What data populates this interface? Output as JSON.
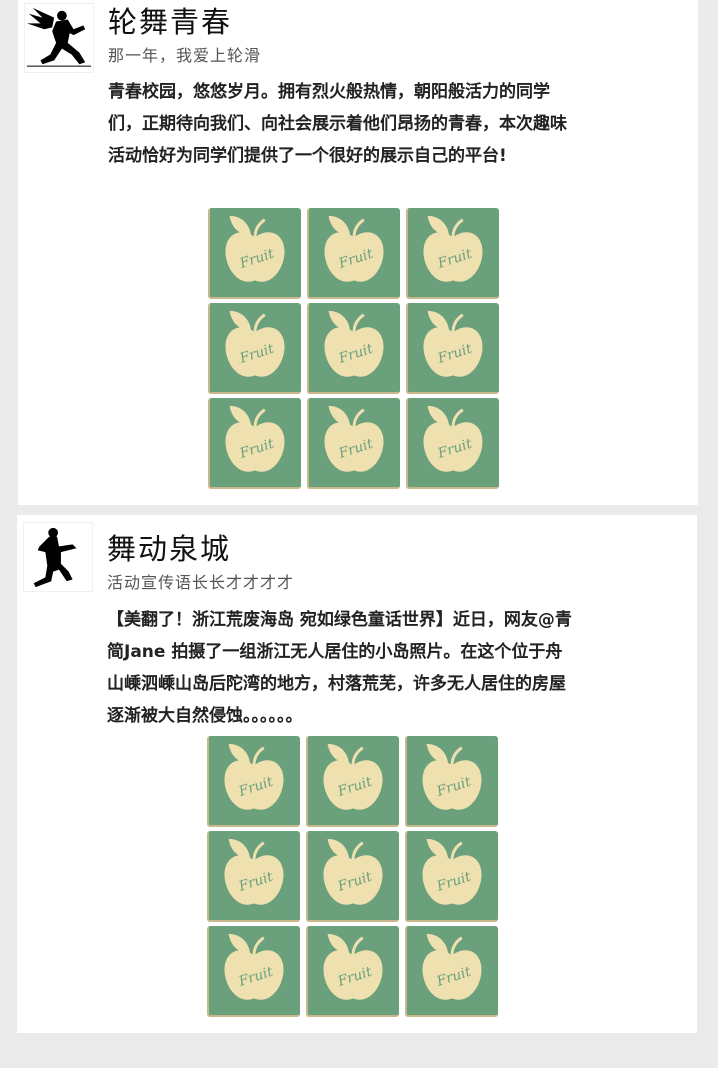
{
  "posts": [
    {
      "title": "轮舞青春",
      "subtitle": "那一年，我爱上轮滑",
      "content": "青春校园，悠悠岁月。拥有烈火般热情，朝阳般活力的同学们，正期待向我们、向社会展示着他们昂扬的青春，本次趣味活动恰好为同学们提供了一个很好的展示自己的平台!",
      "avatar_icon": "winged-skater-silhouette",
      "images": [
        "Fruit",
        "Fruit",
        "Fruit",
        "Fruit",
        "Fruit",
        "Fruit",
        "Fruit",
        "Fruit",
        "Fruit"
      ]
    },
    {
      "title": "舞动泉城",
      "subtitle": "活动宣传语长长才才才才",
      "content": "【美翻了！浙江荒废海岛 宛如绿色童话世界】近日，网友@青简Jane 拍摄了一组浙江无人居住的小岛照片。在这个位于舟山嵊泗嵊山岛后陀湾的地方，村落荒芜，许多无人居住的房屋逐渐被大自然侵蚀。。。。。。",
      "avatar_icon": "dancer-silhouette",
      "images": [
        "Fruit",
        "Fruit",
        "Fruit",
        "Fruit",
        "Fruit",
        "Fruit",
        "Fruit",
        "Fruit",
        "Fruit"
      ]
    }
  ],
  "colors": {
    "page_bg": "#ebebeb",
    "card_bg": "#ffffff",
    "thumb_green": "#6aa07c",
    "apple_cream": "#efe0b0",
    "apple_text": "#6aa07c"
  }
}
